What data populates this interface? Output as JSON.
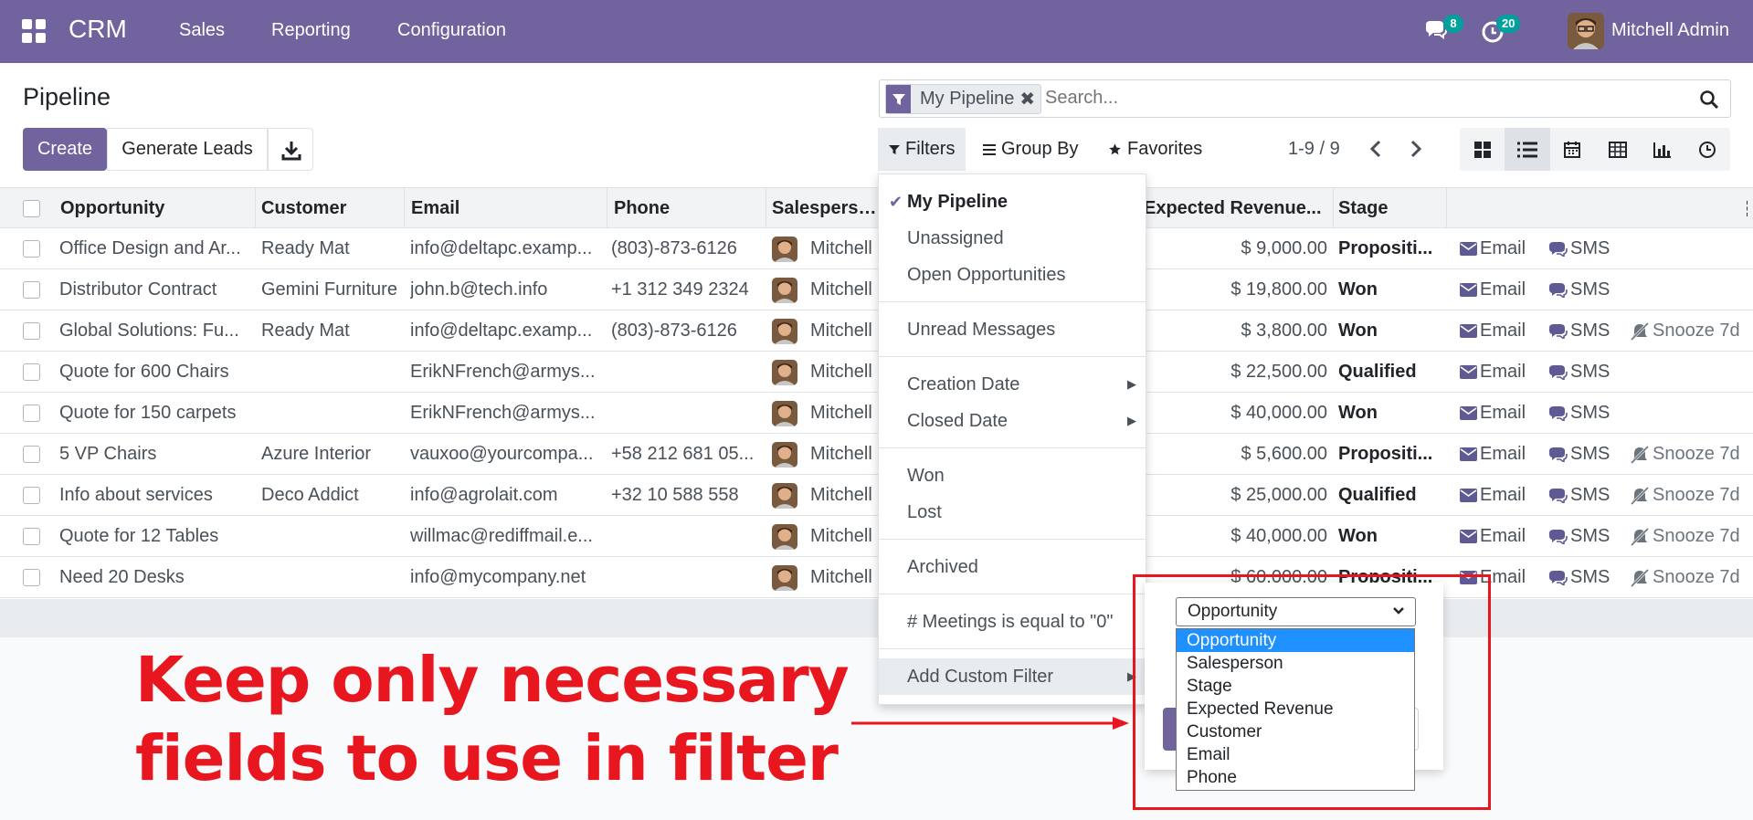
{
  "navbar": {
    "brand": "CRM",
    "menus": [
      "Sales",
      "Reporting",
      "Configuration"
    ],
    "messages_count": "8",
    "activities_count": "20",
    "user_name": "Mitchell Admin"
  },
  "control_panel": {
    "title": "Pipeline",
    "create_label": "Create",
    "generate_label": "Generate Leads",
    "search": {
      "facet_label": "My Pipeline",
      "placeholder": "Search..."
    },
    "filters_label": "Filters",
    "groupby_label": "Group By",
    "favorites_label": "Favorites",
    "pager": "1-9 / 9"
  },
  "table": {
    "headers": {
      "opportunity": "Opportunity",
      "customer": "Customer",
      "email": "Email",
      "phone": "Phone",
      "salesperson": "Salesperson",
      "revenue": "Expected Revenue...",
      "stage": "Stage"
    },
    "action_labels": {
      "email": "Email",
      "sms": "SMS",
      "snooze": "Snooze 7d"
    },
    "rows": [
      {
        "opportunity": "Office Design and Ar...",
        "customer": "Ready Mat",
        "email": "info@deltapc.examp...",
        "phone": "(803)-873-6126",
        "salesperson": "Mitchell",
        "revenue": "$ 9,000.00",
        "stage": "Propositi...",
        "snooze": false
      },
      {
        "opportunity": "Distributor Contract",
        "customer": "Gemini Furniture",
        "email": "john.b@tech.info",
        "phone": "+1 312 349 2324",
        "salesperson": "Mitchell",
        "revenue": "$ 19,800.00",
        "stage": "Won",
        "snooze": false
      },
      {
        "opportunity": "Global Solutions: Fu...",
        "customer": "Ready Mat",
        "email": "info@deltapc.examp...",
        "phone": "(803)-873-6126",
        "salesperson": "Mitchell",
        "revenue": "$ 3,800.00",
        "stage": "Won",
        "snooze": true
      },
      {
        "opportunity": "Quote for 600 Chairs",
        "customer": "",
        "email": "ErikNFrench@armys...",
        "phone": "",
        "salesperson": "Mitchell",
        "revenue": "$ 22,500.00",
        "stage": "Qualified",
        "snooze": false
      },
      {
        "opportunity": "Quote for 150 carpets",
        "customer": "",
        "email": "ErikNFrench@armys...",
        "phone": "",
        "salesperson": "Mitchell",
        "revenue": "$ 40,000.00",
        "stage": "Won",
        "snooze": false
      },
      {
        "opportunity": "5 VP Chairs",
        "customer": "Azure Interior",
        "email": "vauxoo@yourcompa...",
        "phone": "+58 212 681 05...",
        "salesperson": "Mitchell",
        "revenue": "$ 5,600.00",
        "stage": "Propositi...",
        "snooze": true
      },
      {
        "opportunity": "Info about services",
        "customer": "Deco Addict",
        "email": "info@agrolait.com",
        "phone": "+32 10 588 558",
        "salesperson": "Mitchell",
        "revenue": "$ 25,000.00",
        "stage": "Qualified",
        "snooze": true
      },
      {
        "opportunity": "Quote for 12 Tables",
        "customer": "",
        "email": "willmac@rediffmail.e...",
        "phone": "",
        "salesperson": "Mitchell",
        "revenue": "$ 40,000.00",
        "stage": "Won",
        "snooze": true
      },
      {
        "opportunity": "Need 20 Desks",
        "customer": "",
        "email": "info@mycompany.net",
        "phone": "",
        "salesperson": "Mitchell",
        "revenue": "$ 60,000.00",
        "stage": "Propositi...",
        "snooze": true
      }
    ]
  },
  "filters_dropdown": {
    "items": [
      {
        "label": "My Pipeline",
        "checked": true,
        "submenu": false
      },
      {
        "label": "Unassigned",
        "checked": false,
        "submenu": false
      },
      {
        "label": "Open Opportunities",
        "checked": false,
        "submenu": false
      },
      {
        "label": "Unread Messages",
        "checked": false,
        "submenu": false
      },
      {
        "label": "Creation Date",
        "checked": false,
        "submenu": true
      },
      {
        "label": "Closed Date",
        "checked": false,
        "submenu": true
      },
      {
        "label": "Won",
        "checked": false,
        "submenu": false
      },
      {
        "label": "Lost",
        "checked": false,
        "submenu": false
      },
      {
        "label": "Archived",
        "checked": false,
        "submenu": false
      },
      {
        "label": "# Meetings is equal to \"0\"",
        "checked": false,
        "submenu": false
      },
      {
        "label": "Add Custom Filter",
        "checked": false,
        "submenu": true
      }
    ]
  },
  "custom_filter": {
    "selected_field": "Opportunity",
    "options": [
      "Opportunity",
      "Salesperson",
      "Stage",
      "Expected Revenue",
      "Customer",
      "Email",
      "Phone"
    ]
  },
  "annotation": {
    "line1": "Keep only necessary",
    "line2": "fields to use in filter",
    "color": "#e8161e"
  },
  "colors": {
    "brand": "#71639e",
    "badge": "#00a09d",
    "option_highlight": "#1e90ff"
  }
}
